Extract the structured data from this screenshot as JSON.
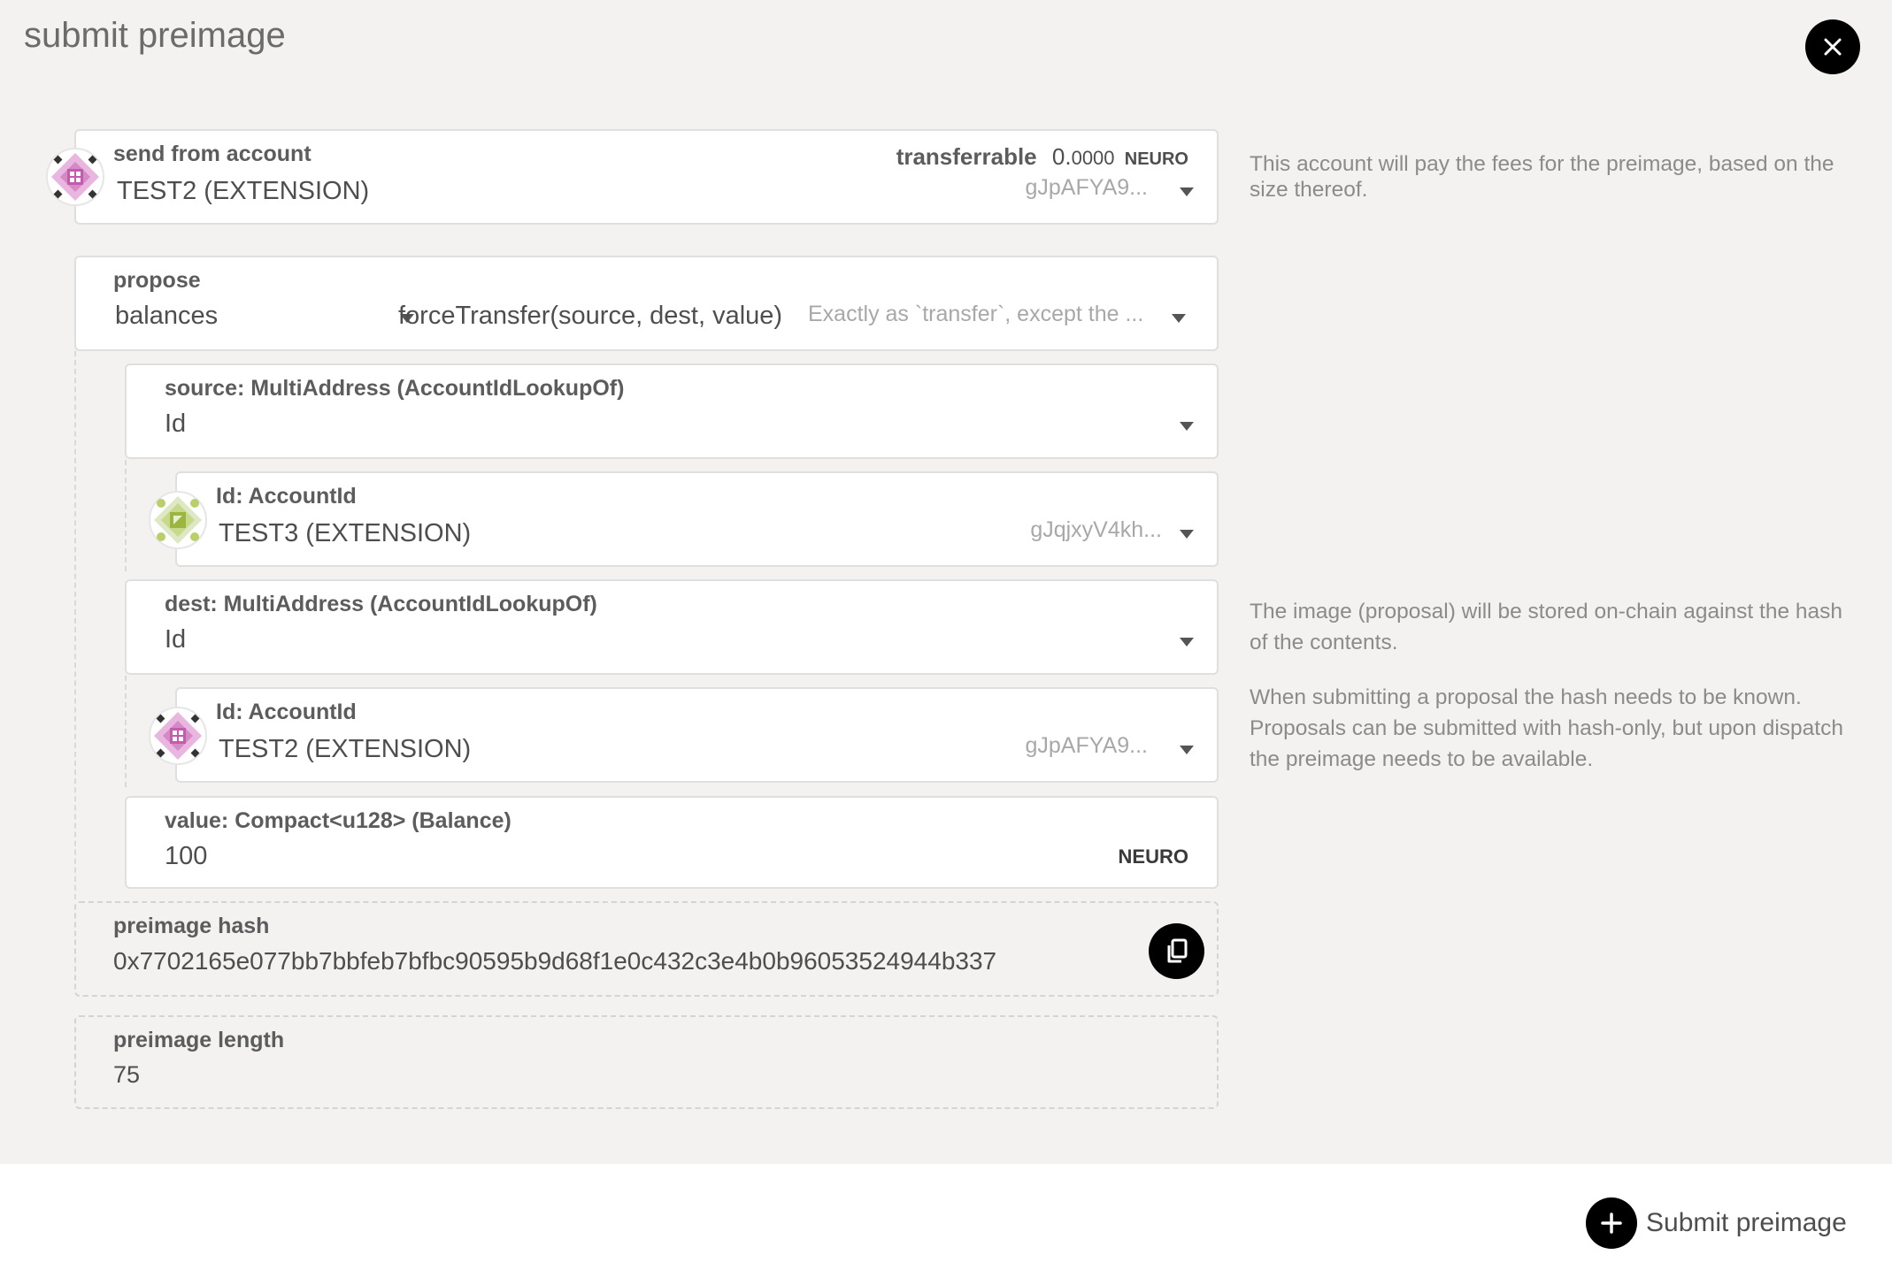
{
  "title": "submit preimage",
  "send_from": {
    "label": "send from account",
    "account_name": "TEST2 (EXTENSION)",
    "transferable_label": "transferrable",
    "transferable_int": "0.",
    "transferable_dec": "0000",
    "unit": "NEURO",
    "address": "gJpAFYA9..."
  },
  "help": {
    "account": "This account will pay the fees for the preimage, based on the size thereof.",
    "proposal_1": "The image (proposal) will be stored on-chain against the hash of the contents.",
    "proposal_2": "When submitting a proposal the hash needs to be known. Proposals can be submitted with hash-only, but upon dispatch the preimage needs to be available."
  },
  "propose": {
    "label": "propose",
    "section": "balances",
    "method": "forceTransfer(source, dest, value)",
    "description": "Exactly as `transfer`, except the ..."
  },
  "source": {
    "label": "source: MultiAddress (AccountIdLookupOf)",
    "variant": "Id",
    "account_label": "Id: AccountId",
    "account_name": "TEST3 (EXTENSION)",
    "address": "gJqjxyV4kh..."
  },
  "dest": {
    "label": "dest: MultiAddress (AccountIdLookupOf)",
    "variant": "Id",
    "account_label": "Id: AccountId",
    "account_name": "TEST2 (EXTENSION)",
    "address": "gJpAFYA9..."
  },
  "value": {
    "label": "value: Compact<u128> (Balance)",
    "amount": "100",
    "unit": "NEURO"
  },
  "preimage_hash": {
    "label": "preimage hash",
    "value": "0x7702165e077bb7bbfeb7bfbc90595b9d68f1e0c432c3e4b0b96053524944b337"
  },
  "preimage_length": {
    "label": "preimage length",
    "value": "75"
  },
  "submit_label": "Submit preimage",
  "icons": {
    "close": "close-icon",
    "copy": "copy-icon",
    "plus": "plus-icon"
  }
}
